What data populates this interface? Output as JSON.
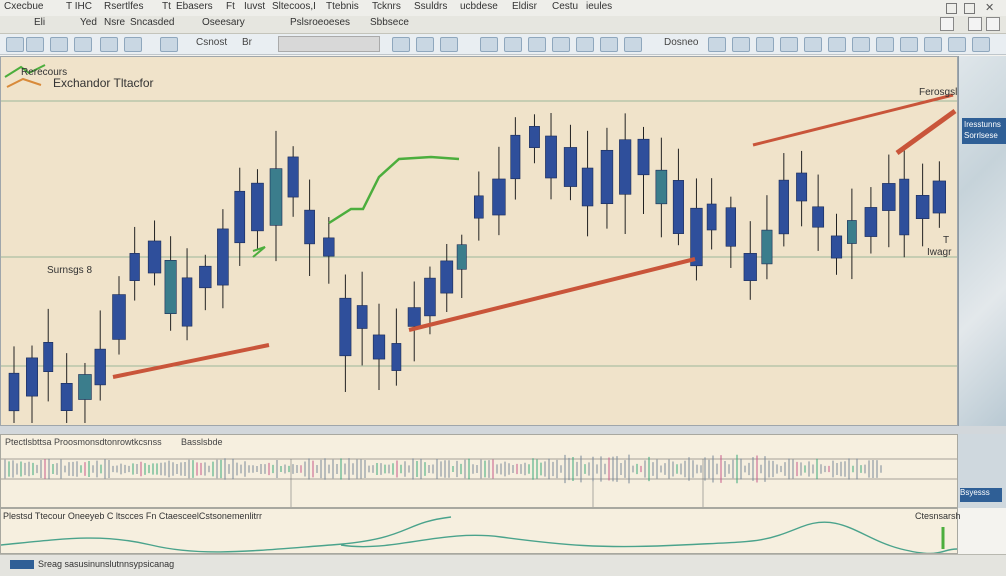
{
  "menubar": {
    "items": [
      "Cxecbue",
      "T IHC",
      "Rsertlfes",
      "Tt",
      "Ebasers",
      "Ft",
      "Iuvst",
      "Sltecoos,I",
      "Ttebnis",
      "Tcknrs",
      "Ssuldrs",
      "ucbdese",
      "Eldisr",
      "Cestu",
      "ieules"
    ]
  },
  "tabs": {
    "items": [
      "Eli",
      "Yed",
      "Nsre",
      "Sncasded",
      "Oseesary",
      "Pslsroeoeses",
      "Sbbsece"
    ]
  },
  "toolbar": {
    "text_a": "Csnost",
    "text_b": "Br",
    "text_c": "Dosneo"
  },
  "chart": {
    "title_small": "Rerecours",
    "title": "Exchandor Tltacfor",
    "label_left": "Surnsgs 8",
    "label_tr": "Ferosgsle",
    "label_r1": "T",
    "label_r2": "Iwagr"
  },
  "right_panel": {
    "block_text_1": "Iresstunns",
    "block_text_2": "Sorrlsese"
  },
  "volume": {
    "header": "Ptectlsbttsa Proosmonsdtonrowtkcsnss",
    "footer": "Basslsbde"
  },
  "oscillator": {
    "header": "Plestsd Ttecour Oneeyeb C ltscces Fn CtaesceelCstsonemenlitrr",
    "right": "Ctesnsarsh",
    "right_badge": "Bsyesss"
  },
  "status": {
    "text": "Sreag sasusinunslutnnsypsicanag"
  },
  "colors": {
    "candle_body": "#2f4f9b",
    "candle_green": "#3b7d8c",
    "trend_red": "#c9553a",
    "trend_green": "#4cae3d",
    "chart_bg": "#f0e3ca"
  }
}
